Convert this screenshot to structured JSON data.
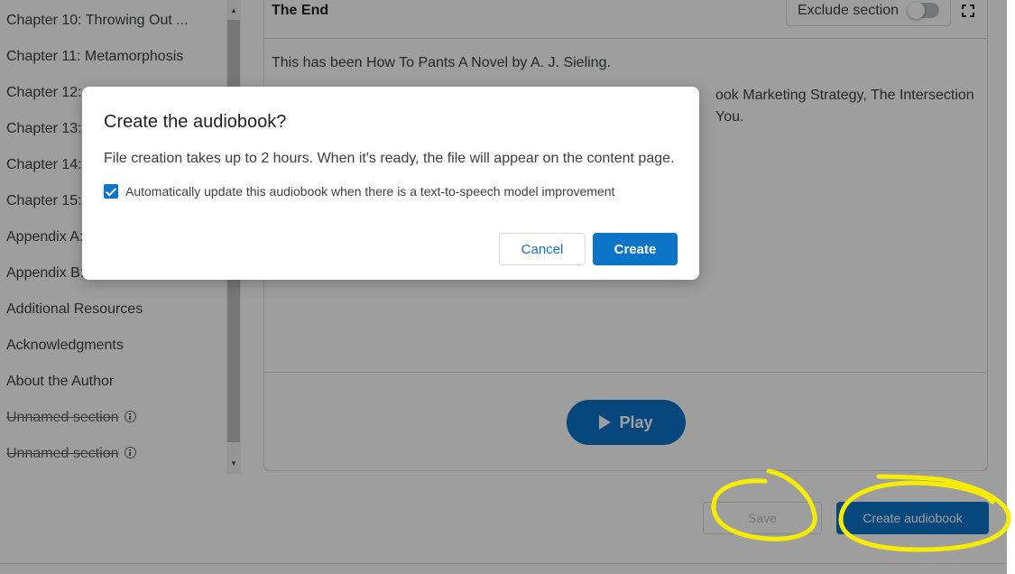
{
  "sidebar": {
    "chapters": [
      {
        "label": "Chapter 10: Throwing Out ...",
        "excluded": false
      },
      {
        "label": "Chapter 11: Metamorphosis",
        "excluded": false
      },
      {
        "label": "Chapter 12:",
        "excluded": false
      },
      {
        "label": "Chapter 13:",
        "excluded": false
      },
      {
        "label": "Chapter 14:",
        "excluded": false
      },
      {
        "label": "Chapter 15:",
        "excluded": false
      },
      {
        "label": "Appendix A:",
        "excluded": false
      },
      {
        "label": "Appendix B:",
        "excluded": false
      },
      {
        "label": "Additional Resources",
        "excluded": false
      },
      {
        "label": "Acknowledgments",
        "excluded": false
      },
      {
        "label": "About the Author",
        "excluded": false
      },
      {
        "label": "Unnamed section",
        "excluded": true
      },
      {
        "label": "Unnamed section",
        "excluded": true
      }
    ]
  },
  "editor": {
    "section_title": "The End",
    "exclude_label": "Exclude section",
    "exclude_on": false,
    "paragraphs": [
      "This has been How To Pants A Novel by A. J. Sieling.",
      "ook Marketing Strategy, The Intersection",
      "You."
    ],
    "play_label": "Play"
  },
  "footer": {
    "save_label": "Save",
    "create_audiobook_label": "Create audiobook"
  },
  "modal": {
    "title": "Create the audiobook?",
    "text": "File creation takes up to 2 hours. When it's ready, the file will appear on the content page.",
    "checkbox_label": "Automatically update this audiobook when there is a text-to-speech model improvement",
    "checkbox_checked": true,
    "cancel_label": "Cancel",
    "create_label": "Create"
  },
  "colors": {
    "primary": "#0b74c7",
    "annotation": "#f5ec00"
  }
}
